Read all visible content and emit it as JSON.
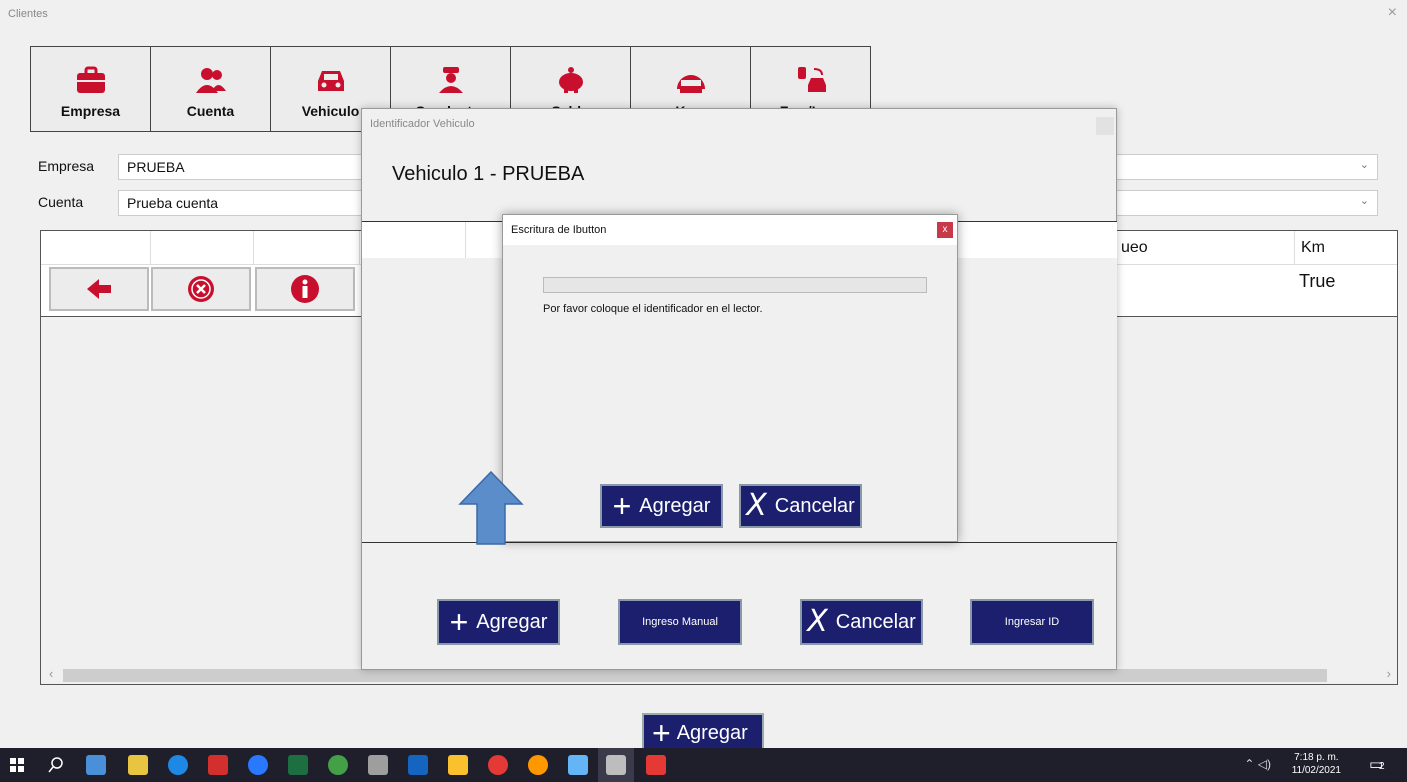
{
  "window": {
    "title": "Clientes",
    "close_glyph": "×"
  },
  "toolbar": {
    "buttons": [
      {
        "label": "Empresa",
        "icon": "briefcase-icon"
      },
      {
        "label": "Cuenta",
        "icon": "users-icon"
      },
      {
        "label": "Vehiculo",
        "icon": "car-icon"
      },
      {
        "label": "Conductor",
        "icon": "driver-icon"
      },
      {
        "label": "Saldo",
        "icon": "piggy-bank-icon"
      },
      {
        "label": "Kms",
        "icon": "odometer-icon"
      },
      {
        "label": "Fzm/Lmp",
        "icon": "fuel-car-icon"
      }
    ]
  },
  "form": {
    "empresa_label": "Empresa",
    "empresa_value": "PRUEBA",
    "cuenta_label": "Cuenta",
    "cuenta_value": "Prueba cuenta"
  },
  "grid": {
    "visible_headers": {
      "bloqueo_partial": "ueo",
      "km": "Km"
    },
    "row": {
      "km_value": "True"
    }
  },
  "bottom_add_label": "Agregar",
  "dialog_identificador": {
    "title": "Identificador Vehiculo",
    "heading": "Vehiculo   1 - PRUEBA",
    "buttons": {
      "agregar": "Agregar",
      "ingreso_manual": "Ingreso Manual",
      "cancelar": "Cancelar",
      "ingresar_id": "Ingresar ID"
    }
  },
  "dialog_ibutton": {
    "title": "Escritura de Ibutton",
    "close_glyph": "x",
    "progress": 0,
    "message": "Por favor coloque el identificador en el lector.",
    "buttons": {
      "agregar": "Agregar",
      "cancelar": "Cancelar"
    }
  },
  "taskbar": {
    "time": "7:18 p. m.",
    "date": "11/02/2021",
    "notification_count": "2"
  },
  "colors": {
    "navy": "#1b1f6e",
    "icon_red": "#c8102e",
    "progress_green": "#06b025",
    "taskbar": "#1f1f2c"
  }
}
